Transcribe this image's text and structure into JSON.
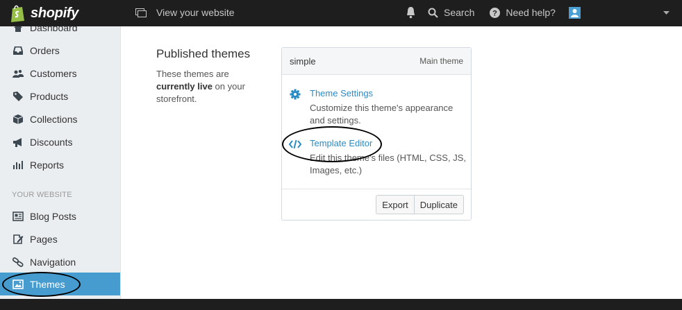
{
  "topbar": {
    "brand": "shopify",
    "view_site": "View your website",
    "search": "Search",
    "help": "Need help?",
    "icons": [
      "shopify-bag-icon",
      "window-icon",
      "bell-icon",
      "search-icon",
      "help-icon",
      "user-avatar-icon",
      "caret-down-icon"
    ]
  },
  "sidebar": {
    "items": [
      {
        "label": "Dashboard",
        "icon": "home-icon"
      },
      {
        "label": "Orders",
        "icon": "inbox-icon"
      },
      {
        "label": "Customers",
        "icon": "users-icon"
      },
      {
        "label": "Products",
        "icon": "tag-icon"
      },
      {
        "label": "Collections",
        "icon": "box-icon"
      },
      {
        "label": "Discounts",
        "icon": "megaphone-icon"
      },
      {
        "label": "Reports",
        "icon": "bar-chart-icon"
      }
    ],
    "section_label": "YOUR WEBSITE",
    "website_items": [
      {
        "label": "Blog Posts",
        "icon": "blog-icon"
      },
      {
        "label": "Pages",
        "icon": "pages-icon"
      },
      {
        "label": "Navigation",
        "icon": "link-icon"
      },
      {
        "label": "Themes",
        "icon": "image-icon",
        "active": true
      }
    ]
  },
  "main": {
    "section_title": "Published themes",
    "section_desc_pre": "These themes are ",
    "section_desc_bold": "currently live",
    "section_desc_post": " on your storefront.",
    "theme": {
      "name": "simple",
      "badge": "Main theme",
      "actions": [
        {
          "title": "Theme Settings",
          "desc": "Customize this theme's appearance and settings.",
          "icon": "gear-icon"
        },
        {
          "title": "Template Editor",
          "desc": "Edit this theme's files (HTML, CSS, JS, Images, etc.)",
          "icon": "code-icon"
        }
      ],
      "buttons": {
        "export": "Export",
        "duplicate": "Duplicate"
      }
    }
  },
  "colors": {
    "topbar": "#1e1e1e",
    "sidebar": "#ebeef0",
    "active": "#479ccf",
    "link": "#2b8bc5"
  }
}
